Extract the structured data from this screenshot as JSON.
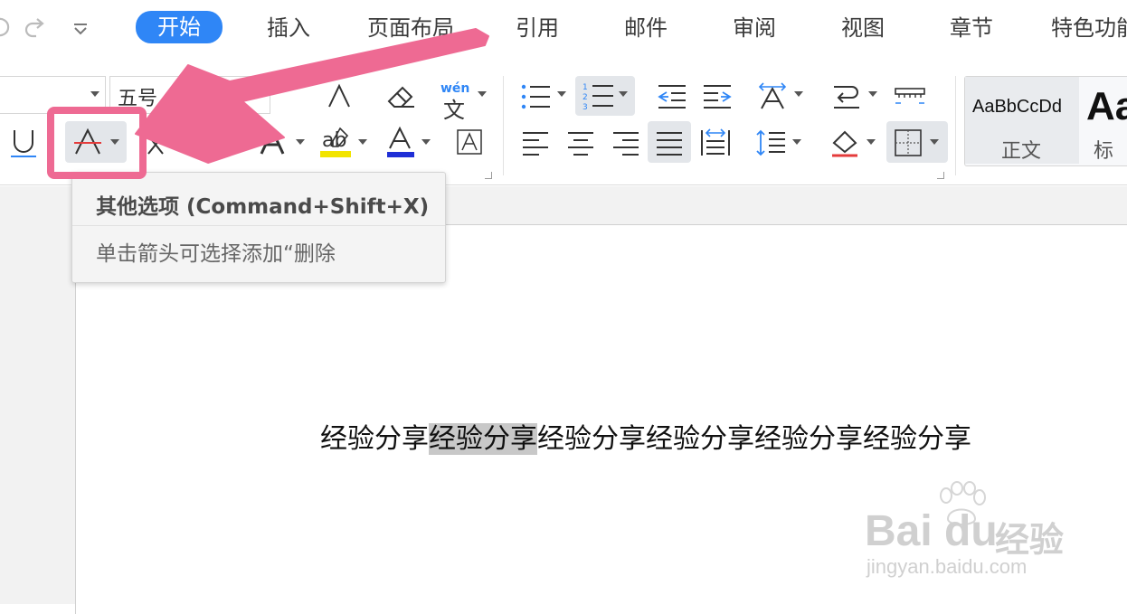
{
  "menubar": {
    "tabs": [
      {
        "label": "开始",
        "active": true
      },
      {
        "label": "插入"
      },
      {
        "label": "页面布局"
      },
      {
        "label": "引用"
      },
      {
        "label": "邮件"
      },
      {
        "label": "审阅"
      },
      {
        "label": "视图"
      },
      {
        "label": "章节"
      },
      {
        "label": "特色功能"
      }
    ]
  },
  "ribbon": {
    "font_size_value": "五号",
    "pinyin_label": "wén",
    "pinyin_char": "文",
    "styles": {
      "normal_preview": "AaBbCcDd",
      "normal_label": "正文",
      "heading_preview": "Aa",
      "heading_label": "标"
    }
  },
  "tooltip": {
    "title": "其他选项 (Command+Shift+X)",
    "description": "单击箭头可选择添加“删除"
  },
  "document": {
    "text_before": "经验分享",
    "text_selected": "经验分享",
    "text_after": "经验分享经验分享经验分享经验分享"
  },
  "watermark": {
    "brand": "Bai",
    "brand_du": "du",
    "brand_cn": "经验",
    "url": "jingyan.baidu.com"
  },
  "colors": {
    "accent": "#2f86f6",
    "annotation": "#ee6a93",
    "highlight_yellow": "#f2e400",
    "font_blue": "#1f2fd6",
    "strike_red": "#e43b3b"
  },
  "icons": [
    "undo-icon",
    "redo-icon",
    "customize-icon",
    "underline-icon",
    "strikethrough-icon",
    "superscript-icon",
    "subscript-icon",
    "text-effect-icon",
    "highlight-icon",
    "font-color-icon",
    "char-border-icon",
    "clear-format-icon",
    "pinyin-icon",
    "bullets-icon",
    "numbering-icon",
    "decrease-indent-icon",
    "increase-indent-icon",
    "text-direction-icon",
    "line-break-icon",
    "ruler-icon",
    "align-left-icon",
    "align-center-icon",
    "align-right-icon",
    "justify-icon",
    "distribute-icon",
    "line-spacing-icon",
    "shading-icon",
    "borders-icon"
  ]
}
